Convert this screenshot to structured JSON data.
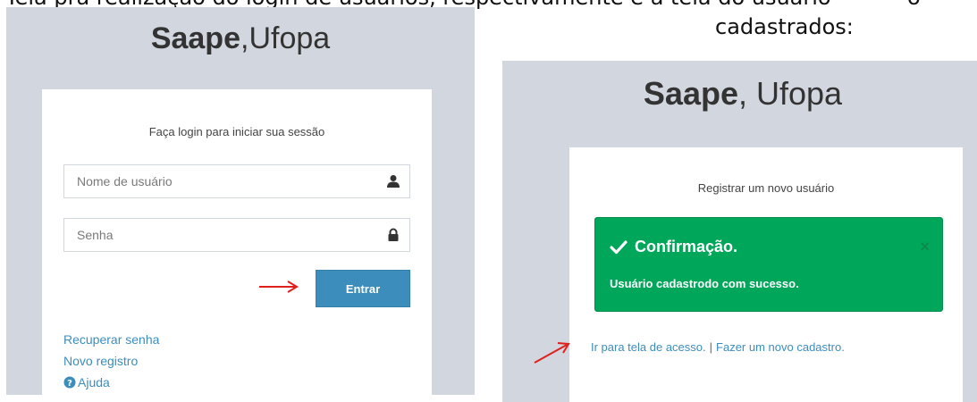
{
  "document": {
    "top_left_fragment": "Tela pra realização do login de usuários, respectivamente e a tela do usuário",
    "top_right_fragment": "ó",
    "caption": "cadastrados:"
  },
  "login_screen": {
    "brand_bold": "Saape",
    "brand_rest": ",Ufopa",
    "message": "Faça login para iniciar sua sessão",
    "username_placeholder": "Nome de usuário",
    "password_placeholder": "Senha",
    "submit_label": "Entrar",
    "recover_link": "Recuperar senha",
    "register_link": "Novo registro",
    "help_link": "Ajuda",
    "icons": {
      "username": "user-icon",
      "password": "lock-icon",
      "help": "question-circle-icon",
      "annotation": "red-arrow"
    }
  },
  "register_screen": {
    "brand_bold": "Saape",
    "brand_rest": ", Ufopa",
    "message": "Registrar um novo usuário",
    "alert_title": "Confirmação.",
    "alert_body": "Usuário cadastrodo com sucesso.",
    "alert_close": "×",
    "access_link": "Ir para tela de acesso.",
    "separator": "|",
    "new_register_link": "Fazer um novo cadastro.",
    "icons": {
      "alert": "check-icon",
      "annotation": "red-arrow"
    }
  },
  "colors": {
    "page_background": "#d2d6de",
    "primary_button": "#3c8dbc",
    "success_alert": "#00a65a",
    "annotation_arrow": "#e0201c"
  }
}
